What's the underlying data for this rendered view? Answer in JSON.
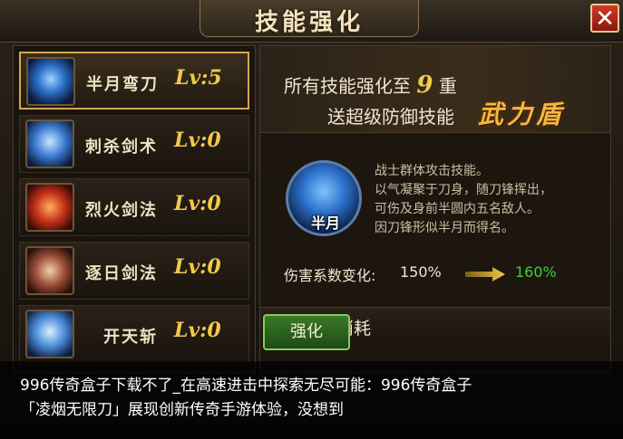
{
  "window": {
    "title": "技能强化",
    "close_label": "✕"
  },
  "skills": [
    {
      "name": "半月弯刀",
      "level": "Lv:5",
      "selected": true,
      "icon": "crescent-blade-icon"
    },
    {
      "name": "刺杀剑术",
      "level": "Lv:0",
      "selected": false,
      "icon": "assassin-sword-icon"
    },
    {
      "name": "烈火剑法",
      "level": "Lv:0",
      "selected": false,
      "icon": "fire-sword-icon"
    },
    {
      "name": "逐日剑法",
      "level": "Lv:0",
      "selected": false,
      "icon": "sun-chase-sword-icon"
    },
    {
      "name": "开天斩",
      "level": "Lv:0",
      "selected": false,
      "icon": "sky-cleave-icon"
    }
  ],
  "banner": {
    "line1_prefix": "所有技能强化至",
    "line1_num": "9",
    "line1_suffix": "重",
    "line2": "送超级防御技能",
    "skill_name": "武力盾"
  },
  "detail": {
    "orb_label": "半月",
    "description": [
      "战士群体攻击技能。",
      "以气凝聚于刀身，随刀锋挥出，",
      "可伤及身前半圆内五名敌人。",
      "因刀锋形似半月而得名。"
    ],
    "damage_label": "伤害系数变化:",
    "damage_from": "150%",
    "damage_to": "160%"
  },
  "cost": {
    "label": "强化消耗"
  },
  "enhance_button": "强化",
  "caption": {
    "line1": "996传奇盒子下载不了_在高速进击中探索无尽可能：996传奇盒子",
    "line2": "「凌烟无限刀」展现创新传奇手游体验，没想到"
  },
  "colors": {
    "gold": "#f2c94a",
    "green": "#3bd23b",
    "orange": "#f3b640"
  }
}
